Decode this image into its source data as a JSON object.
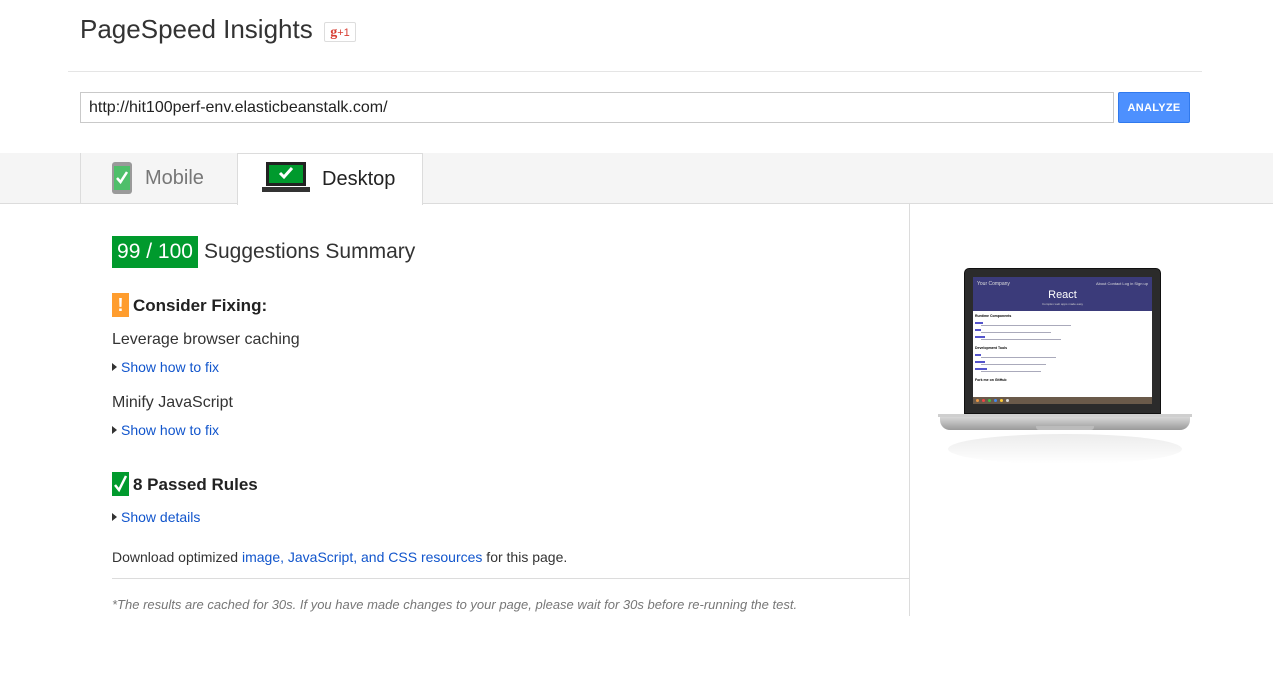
{
  "header": {
    "title": "PageSpeed Insights",
    "gplus_label": "+1"
  },
  "search": {
    "url": "http://hit100perf-env.elasticbeanstalk.com/",
    "analyze_label": "ANALYZE"
  },
  "tabs": [
    {
      "label": "Mobile",
      "active": false
    },
    {
      "label": "Desktop",
      "active": true
    }
  ],
  "summary": {
    "score": "99 / 100",
    "title": "Suggestions Summary",
    "consider_heading": "Consider Fixing:",
    "rules": [
      {
        "name": "Leverage browser caching",
        "link": "Show how to fix"
      },
      {
        "name": "Minify JavaScript",
        "link": "Show how to fix"
      }
    ],
    "passed_heading": "8 Passed Rules",
    "passed_link": "Show details",
    "download_prefix": "Download optimized ",
    "download_link": "image, JavaScript, and CSS resources",
    "download_suffix": " for this page.",
    "cached_note": "*The results are cached for 30s. If you have made changes to your page, please wait for 30s before re-running the test."
  },
  "preview": {
    "company": "Your Company",
    "nav": "About  Contact  Log in  Sign up",
    "hero_title": "React",
    "hero_sub": "Complex web apps made easy",
    "section1": "Runtime Components",
    "section2": "Development Tools",
    "section3": "Fork me on GitHub"
  },
  "colors": {
    "score_green": "#009a2d",
    "warn_orange": "#ff9d2e",
    "link_blue": "#15c",
    "analyze_blue": "#4d90fe"
  }
}
